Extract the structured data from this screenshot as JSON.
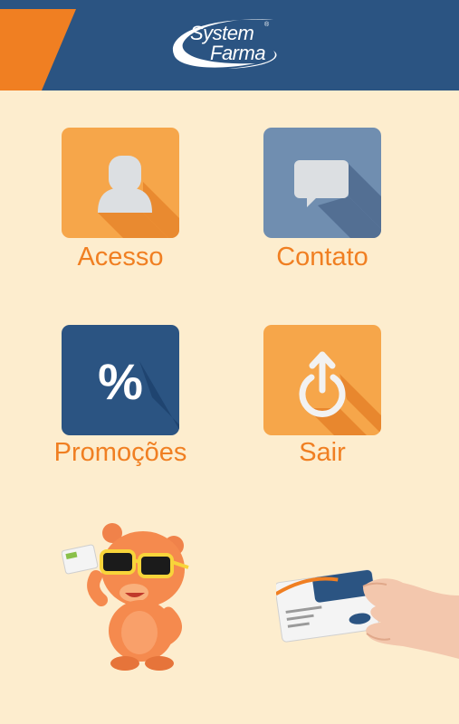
{
  "header": {
    "logo_line1": "System",
    "logo_line2": "Farma",
    "logo_reg": "®"
  },
  "menu": {
    "items": [
      {
        "label": "Acesso",
        "icon": "user-icon",
        "color": "#f6a64a"
      },
      {
        "label": "Contato",
        "icon": "chat-bubble-icon",
        "color": "#708eb0"
      },
      {
        "label": "Promoções",
        "icon": "percent-icon",
        "color": "#2b5482"
      },
      {
        "label": "Sair",
        "icon": "power-icon",
        "color": "#f6a64a"
      }
    ]
  },
  "colors": {
    "background": "#fdedce",
    "header": "#2b5482",
    "accent": "#f07f22"
  }
}
